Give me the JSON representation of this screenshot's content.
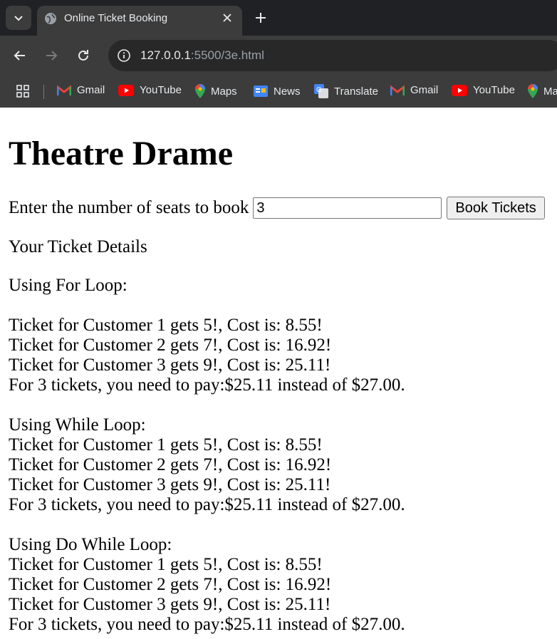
{
  "browser": {
    "tab_title": "Online Ticket Booking",
    "url_host": "127.0.0.1",
    "url_rest": ":5500/3e.html",
    "bookmarks": [
      {
        "label": "Gmail",
        "icon": "gmail-icon"
      },
      {
        "label": "YouTube",
        "icon": "youtube-icon"
      },
      {
        "label": "Maps",
        "icon": "maps-icon"
      },
      {
        "label": "News",
        "icon": "news-icon"
      },
      {
        "label": "Translate",
        "icon": "translate-icon"
      },
      {
        "label": "Gmail",
        "icon": "gmail-icon"
      },
      {
        "label": "YouTube",
        "icon": "youtube-icon"
      },
      {
        "label": "Ma",
        "icon": "maps-icon"
      }
    ]
  },
  "page": {
    "title": "Theatre Drame",
    "prompt": "Enter the number of seats to book",
    "seats_value": "3",
    "book_button": "Book Tickets",
    "details_heading": "Your Ticket Details",
    "for_loop": {
      "heading": "Using For Loop:",
      "lines": [
        "Ticket for Customer 1 gets 5!, Cost is: 8.55!",
        "Ticket for Customer 2 gets 7!, Cost is: 16.92!",
        "Ticket for Customer 3 gets 9!, Cost is: 25.11!",
        "For 3 tickets, you need to pay:$25.11 instead of $27.00."
      ]
    },
    "while_loop": {
      "heading": "Using While Loop:",
      "lines": [
        "Ticket for Customer 1 gets 5!, Cost is: 8.55!",
        "Ticket for Customer 2 gets 7!, Cost is: 16.92!",
        "Ticket for Customer 3 gets 9!, Cost is: 25.11!",
        "For 3 tickets, you need to pay:$25.11 instead of $27.00."
      ]
    },
    "do_while_loop": {
      "heading": "Using Do While Loop:",
      "lines": [
        "Ticket for Customer 1 gets 5!, Cost is: 8.55!",
        "Ticket for Customer 2 gets 7!, Cost is: 16.92!",
        "Ticket for Customer 3 gets 9!, Cost is: 25.11!",
        "For 3 tickets, you need to pay:$25.11 instead of $27.00."
      ]
    }
  }
}
